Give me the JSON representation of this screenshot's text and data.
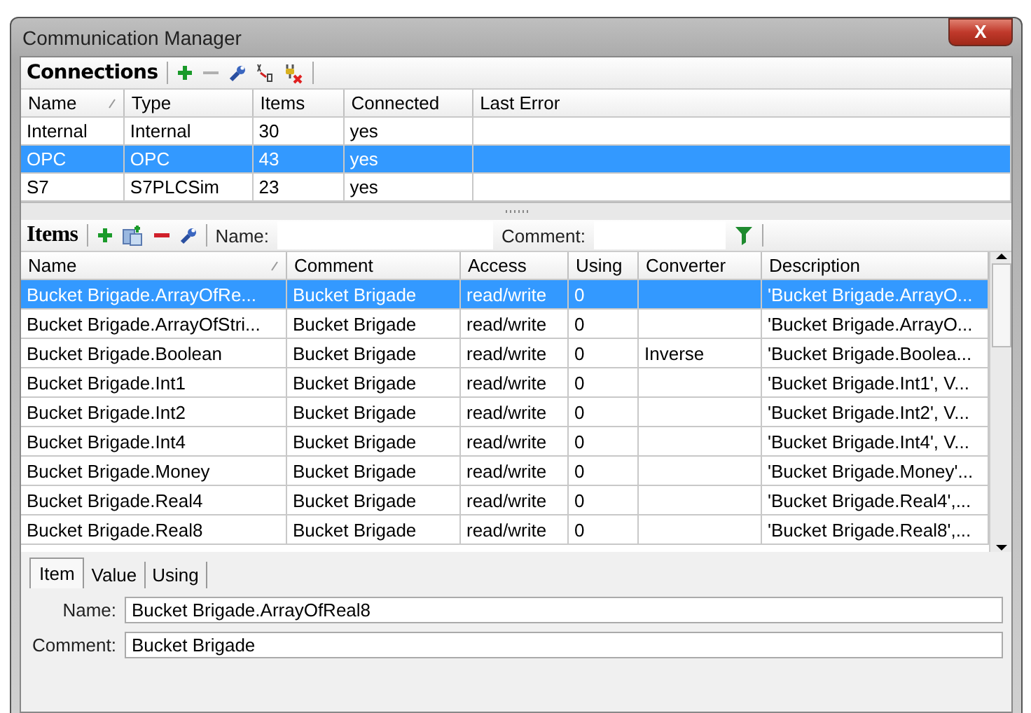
{
  "window": {
    "title": "Communication Manager",
    "close": "X"
  },
  "connections": {
    "title": "Connections",
    "columns": [
      {
        "label": "Name",
        "sorted": true
      },
      {
        "label": "Type",
        "sorted": false
      },
      {
        "label": "Items",
        "sorted": false
      },
      {
        "label": "Connected",
        "sorted": false
      },
      {
        "label": "Last Error",
        "sorted": false
      }
    ],
    "rows": [
      {
        "cells": [
          "Internal",
          "Internal",
          "30",
          "yes",
          ""
        ],
        "selected": false
      },
      {
        "cells": [
          "OPC",
          "OPC",
          "43",
          "yes",
          ""
        ],
        "selected": true
      },
      {
        "cells": [
          "S7",
          "S7PLCSim",
          "23",
          "yes",
          ""
        ],
        "selected": false
      }
    ]
  },
  "items": {
    "title": "Items",
    "filters": [
      {
        "label": "Name:"
      },
      {
        "label": "Comment:"
      }
    ],
    "columns": [
      {
        "label": "Name",
        "sorted": true
      },
      {
        "label": "Comment",
        "sorted": false
      },
      {
        "label": "Access",
        "sorted": false
      },
      {
        "label": "Using",
        "sorted": false
      },
      {
        "label": "Converter",
        "sorted": false
      },
      {
        "label": "Description",
        "sorted": false
      }
    ],
    "rows": [
      {
        "cells": [
          "Bucket Brigade.ArrayOfRe...",
          "Bucket Brigade",
          "read/write",
          "0",
          "",
          "'Bucket Brigade.ArrayO..."
        ],
        "selected": true
      },
      {
        "cells": [
          "Bucket Brigade.ArrayOfStri...",
          "Bucket Brigade",
          "read/write",
          "0",
          "",
          "'Bucket Brigade.ArrayO..."
        ],
        "selected": false
      },
      {
        "cells": [
          "Bucket Brigade.Boolean",
          "Bucket Brigade",
          "read/write",
          "0",
          "Inverse",
          "'Bucket Brigade.Boolea..."
        ],
        "selected": false
      },
      {
        "cells": [
          "Bucket Brigade.Int1",
          "Bucket Brigade",
          "read/write",
          "0",
          "",
          "'Bucket Brigade.Int1', V..."
        ],
        "selected": false
      },
      {
        "cells": [
          "Bucket Brigade.Int2",
          "Bucket Brigade",
          "read/write",
          "0",
          "",
          "'Bucket Brigade.Int2', V..."
        ],
        "selected": false
      },
      {
        "cells": [
          "Bucket Brigade.Int4",
          "Bucket Brigade",
          "read/write",
          "0",
          "",
          "'Bucket Brigade.Int4', V..."
        ],
        "selected": false
      },
      {
        "cells": [
          "Bucket Brigade.Money",
          "Bucket Brigade",
          "read/write",
          "0",
          "",
          "'Bucket Brigade.Money'..."
        ],
        "selected": false
      },
      {
        "cells": [
          "Bucket Brigade.Real4",
          "Bucket Brigade",
          "read/write",
          "0",
          "",
          "'Bucket Brigade.Real4',..."
        ],
        "selected": false
      },
      {
        "cells": [
          "Bucket Brigade.Real8",
          "Bucket Brigade",
          "read/write",
          "0",
          "",
          "'Bucket Brigade.Real8',..."
        ],
        "selected": false
      }
    ]
  },
  "details": {
    "tabs": [
      {
        "label": "Item",
        "selected": true
      },
      {
        "label": "Value",
        "selected": false
      },
      {
        "label": "Using",
        "selected": false
      }
    ],
    "fields": [
      {
        "label": "Name:",
        "value": "Bucket Brigade.ArrayOfReal8"
      },
      {
        "label": "Comment:",
        "value": "Bucket Brigade"
      }
    ]
  }
}
